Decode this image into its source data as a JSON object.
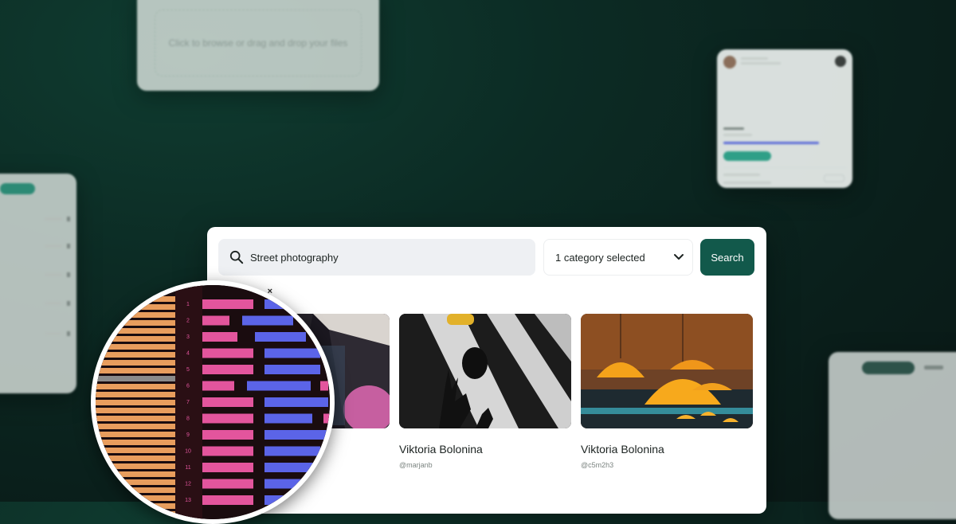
{
  "search": {
    "query": "Street photography",
    "category_label": "1 category selected",
    "button_label": "Search",
    "chip_close": "×"
  },
  "results": [
    {
      "author": "",
      "handle": ""
    },
    {
      "author": "Viktoria Bolonina",
      "handle": "@marjanb"
    },
    {
      "author": "Viktoria Bolonina",
      "handle": "@c5m2h3"
    }
  ],
  "background_cards": {
    "upload_text": "Click to browse or drag and drop your files"
  },
  "magnifier": {
    "line_numbers": [
      "1",
      "2",
      "3",
      "4",
      "5",
      "6",
      "7",
      "8",
      "9",
      "10",
      "11",
      "12",
      "13"
    ]
  },
  "colors": {
    "accent": "#12594b",
    "pink": "#e3559d",
    "blue": "#5b64e8",
    "orange": "#e89d5d"
  }
}
